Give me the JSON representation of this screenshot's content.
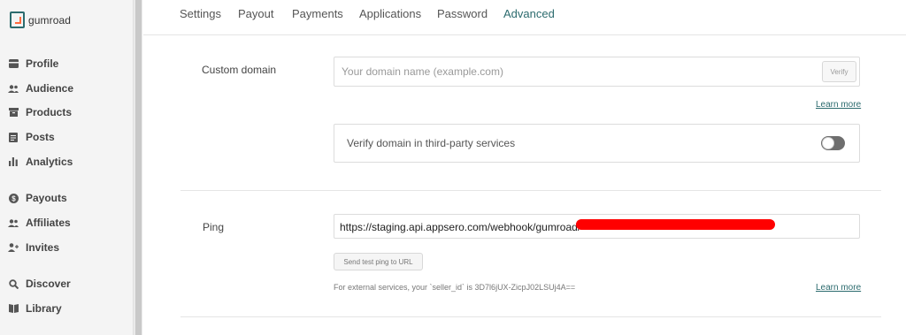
{
  "brand": {
    "name": "gumroad",
    "colors": {
      "accent": "#2c6b6e",
      "orange": "#ff6a3d"
    }
  },
  "sidebar": {
    "items": [
      {
        "label": "Profile",
        "icon": "card-icon"
      },
      {
        "label": "Audience",
        "icon": "people-icon"
      },
      {
        "label": "Products",
        "icon": "archive-icon"
      },
      {
        "label": "Posts",
        "icon": "document-icon"
      },
      {
        "label": "Analytics",
        "icon": "bar-chart-icon"
      },
      {
        "label": "Payouts",
        "icon": "dollar-circle-icon"
      },
      {
        "label": "Affiliates",
        "icon": "people-icon"
      },
      {
        "label": "Invites",
        "icon": "person-add-icon"
      },
      {
        "label": "Discover",
        "icon": "search-icon"
      },
      {
        "label": "Library",
        "icon": "book-icon"
      }
    ]
  },
  "tabs": [
    {
      "label": "Settings"
    },
    {
      "label": "Payout"
    },
    {
      "label": "Payments"
    },
    {
      "label": "Applications"
    },
    {
      "label": "Password"
    },
    {
      "label": "Advanced",
      "active": true
    }
  ],
  "custom_domain": {
    "label": "Custom domain",
    "placeholder": "Your domain name (example.com)",
    "verify_label": "Verify",
    "learn_more": "Learn more",
    "third_party_label": "Verify domain in third-party services",
    "third_party_enabled": false
  },
  "ping": {
    "label": "Ping",
    "url": "https://staging.api.appsero.com/webhook/gumroad/",
    "send_button": "Send test ping to URL",
    "note": "For external services, your `seller_id` is 3D7l6jUX-ZicpJ02LSUj4A==",
    "learn_more": "Learn more"
  }
}
